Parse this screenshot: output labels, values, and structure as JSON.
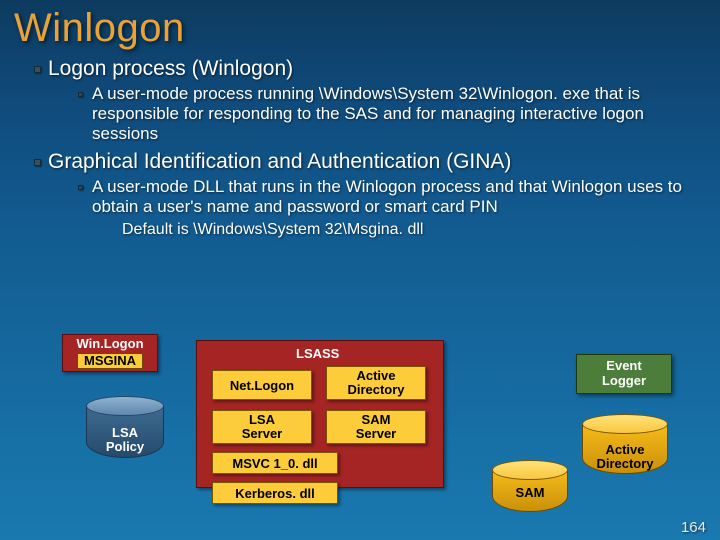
{
  "title": "Winlogon",
  "bullets": [
    {
      "text": "Logon process (Winlogon)",
      "sub": [
        {
          "text": "A user-mode process running \\Windows\\System 32\\Winlogon. exe that is responsible for responding to the SAS and for managing interactive logon sessions"
        }
      ]
    },
    {
      "text": "Graphical Identification and Authentication (GINA)",
      "sub": [
        {
          "text": "A user-mode DLL that runs in the Winlogon process and that Winlogon uses to obtain a user's name and password or smart card PIN",
          "sub3": [
            {
              "text": "Default is \\Windows\\System 32\\Msgina. dll"
            }
          ]
        }
      ]
    }
  ],
  "diagram": {
    "winlogon": {
      "line1": "Win.Logon",
      "line2": "MSGINA"
    },
    "lsass_label": "LSASS",
    "netlogon": "Net.Logon",
    "ad_box": "Active\nDirectory",
    "lsa_server": "LSA\nServer",
    "sam_server": "SAM\nServer",
    "msvc": "MSVC 1_0. dll",
    "kerberos": "Kerberos. dll",
    "lsa_policy": "LSA\nPolicy",
    "event_logger": "Event\nLogger",
    "ad_cyl": "Active\nDirectory",
    "sam_cyl": "SAM"
  },
  "slide_number": "164"
}
